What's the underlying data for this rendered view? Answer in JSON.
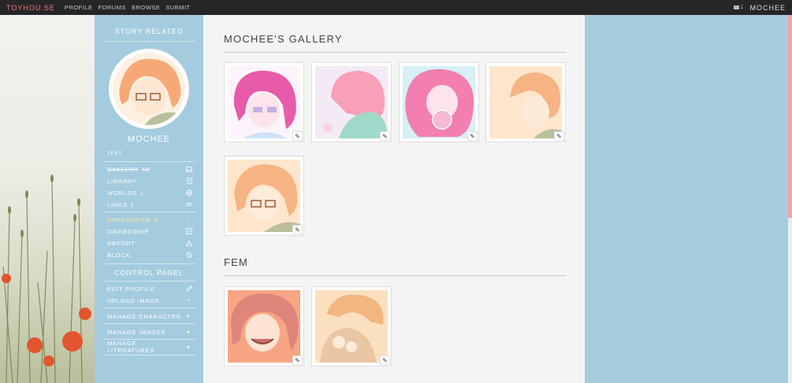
{
  "nav": {
    "brand": "TOYHOU.SE",
    "links": [
      "PROFILE",
      "FORUMS",
      "BROWSE",
      "SUBMIT"
    ],
    "message_count": "1",
    "username": "MOCHEE"
  },
  "sidebar": {
    "story_heading": "STORY RELATED",
    "character_name": "MOCHEE",
    "tagline": "TEST",
    "items": [
      {
        "label": "GALLERY",
        "count": "12",
        "icon": "image-icon"
      },
      {
        "label": "LIBRARY",
        "count": "",
        "icon": "book-icon"
      },
      {
        "label": "WORLDS",
        "count": "1",
        "icon": "globe-icon"
      },
      {
        "label": "LINKS",
        "count": "1",
        "icon": "link-icon"
      }
    ],
    "actions": [
      {
        "label": "UNFAVORITE",
        "count": "3",
        "icon": "star-icon"
      },
      {
        "label": "OWNERSHIP",
        "count": "",
        "icon": "checkbox-icon"
      },
      {
        "label": "REPORT",
        "count": "",
        "icon": "warning-icon"
      },
      {
        "label": "BLOCK",
        "count": "",
        "icon": "ban-icon"
      }
    ],
    "control_heading": "CONTROL PANEL",
    "controls": [
      {
        "label": "EDIT PROFILE",
        "icon": "pencil-icon"
      },
      {
        "label": "UPLOAD IMAGE",
        "icon": "plus-icon"
      }
    ],
    "manage": [
      {
        "label": "MANAGE CHARACTER",
        "icon": "caret-right-icon"
      },
      {
        "label": "MANAGE IMAGES",
        "icon": "caret-right-icon"
      },
      {
        "label": "MANAGE LITERATURES",
        "icon": "caret-right-icon"
      }
    ]
  },
  "main": {
    "gallery_title": "MOCHEE'S GALLERY",
    "fem_title": "FEM",
    "gallery_images": [
      {
        "palette": [
          "#e85aaa",
          "#fbd2e8",
          "#a08de0"
        ]
      },
      {
        "palette": [
          "#f7a0b8",
          "#f9d4de",
          "#9fd9c9"
        ]
      },
      {
        "palette": [
          "#f27fae",
          "#c9eef5",
          "#f7b8d2"
        ]
      },
      {
        "palette": [
          "#f6b383",
          "#fde6cc",
          "#f6c9a0"
        ]
      },
      {
        "palette": [
          "#f6b383",
          "#fde6cc",
          "#f6c9a0"
        ]
      }
    ],
    "fem_images": [
      {
        "palette": [
          "#e0857a",
          "#f7a583",
          "#c8906f"
        ]
      },
      {
        "palette": [
          "#f2b680",
          "#fbe0c0",
          "#e9c6a4"
        ]
      }
    ]
  },
  "colors": {
    "topbar": "#262626",
    "brand": "#f07a7a",
    "sidebar": "#a4cbde",
    "panel": "#f4f4f4",
    "favorite": "#f8ecae"
  }
}
